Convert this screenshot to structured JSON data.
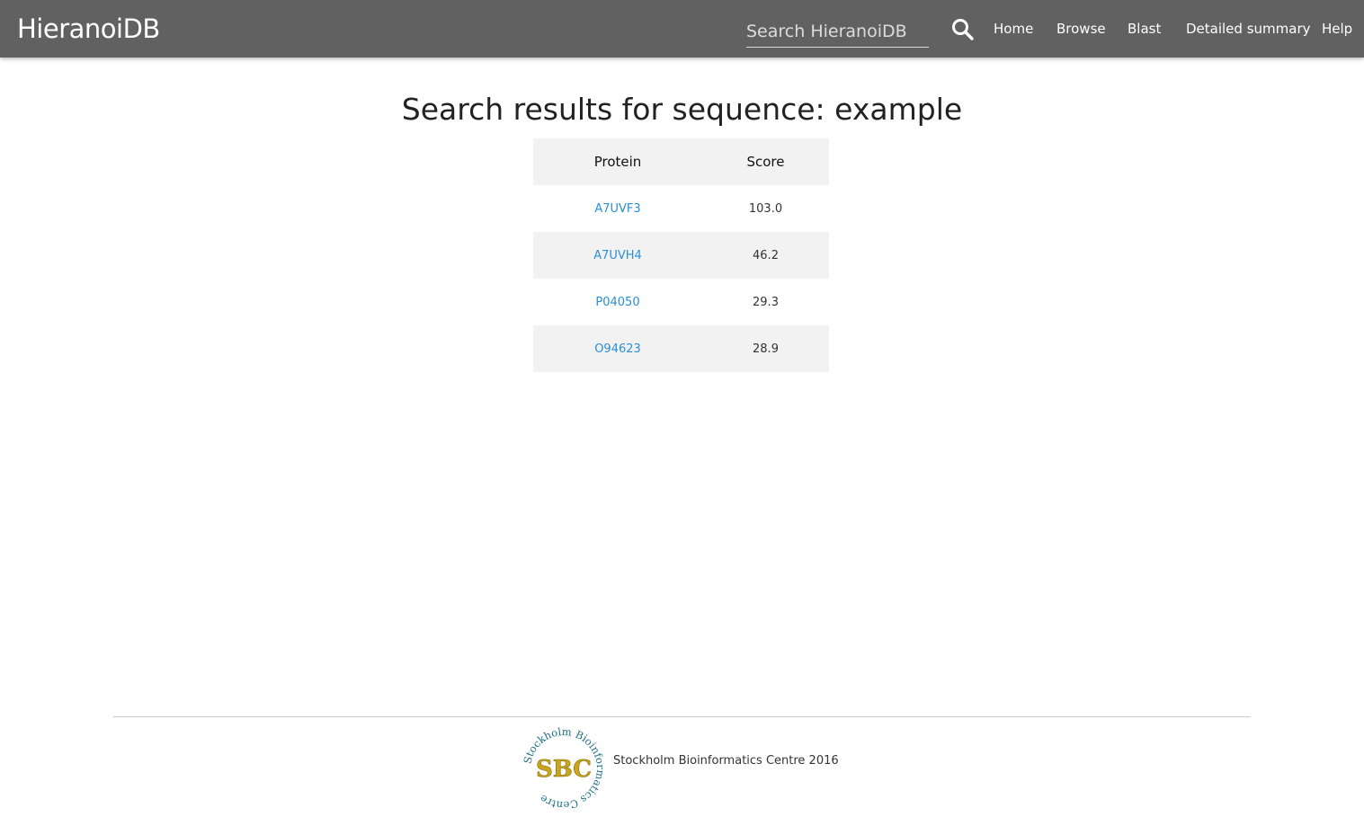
{
  "header": {
    "brand": "HieranoiDB",
    "search_placeholder": "Search HieranoiDB",
    "search_icon": "search-icon",
    "nav": [
      {
        "label": "Home"
      },
      {
        "label": "Browse"
      },
      {
        "label": "Blast"
      },
      {
        "label": "Detailed summary"
      },
      {
        "label": "Help"
      }
    ]
  },
  "main": {
    "title": "Search results for sequence: example",
    "table": {
      "headers": [
        "Protein",
        "Score"
      ],
      "rows": [
        {
          "protein": "A7UVF3",
          "score": "103.0"
        },
        {
          "protein": "A7UVH4",
          "score": "46.2"
        },
        {
          "protein": "P04050",
          "score": "29.3"
        },
        {
          "protein": "O94623",
          "score": "28.9"
        }
      ]
    }
  },
  "footer": {
    "logo_text": "SBC",
    "logo_ring_text": "Stockholm Bioinformatics Centre",
    "text": "Stockholm Bioinformatics Centre 2016"
  },
  "colors": {
    "navbar": "#616161",
    "link": "#2b8fd6",
    "stripe": "#f2f2f2",
    "logo_gold": "#c8a51c",
    "logo_teal": "#1f6f86"
  }
}
